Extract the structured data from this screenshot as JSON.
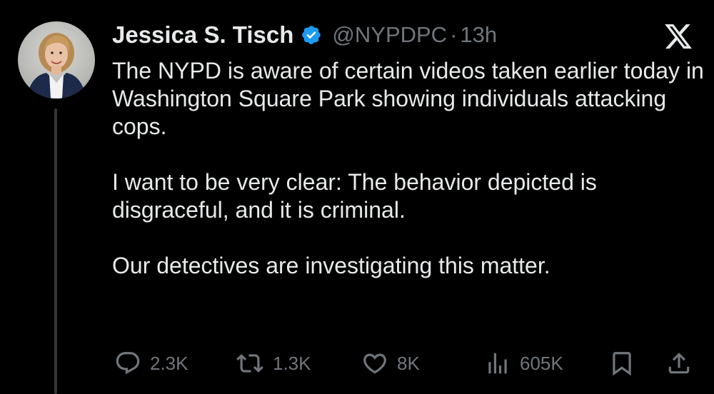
{
  "author": {
    "display_name": "Jessica S. Tisch",
    "handle": "@NYPDPC",
    "separator": "·",
    "time": "13h",
    "verified": true
  },
  "tweet": {
    "paragraphs": [
      "The NYPD is aware of certain videos taken earlier today in Washington Square Park showing individuals attacking cops.",
      "I want to be very clear: The behavior depicted is disgraceful, and it is criminal.",
      "Our detectives are investigating this matter."
    ]
  },
  "actions": {
    "replies": "2.3K",
    "reposts": "1.3K",
    "likes": "8K",
    "views": "605K"
  },
  "icons": {
    "verified": "verified-badge-icon",
    "brand": "x-logo-icon",
    "reply": "reply-icon",
    "repost": "repost-icon",
    "like": "like-icon",
    "views": "views-icon",
    "bookmark": "bookmark-icon",
    "share": "share-icon"
  },
  "colors": {
    "background": "#000000",
    "text": "#e7e9ea",
    "muted": "#71767b",
    "verified": "#1d9bf0",
    "thread_line": "#333639"
  }
}
